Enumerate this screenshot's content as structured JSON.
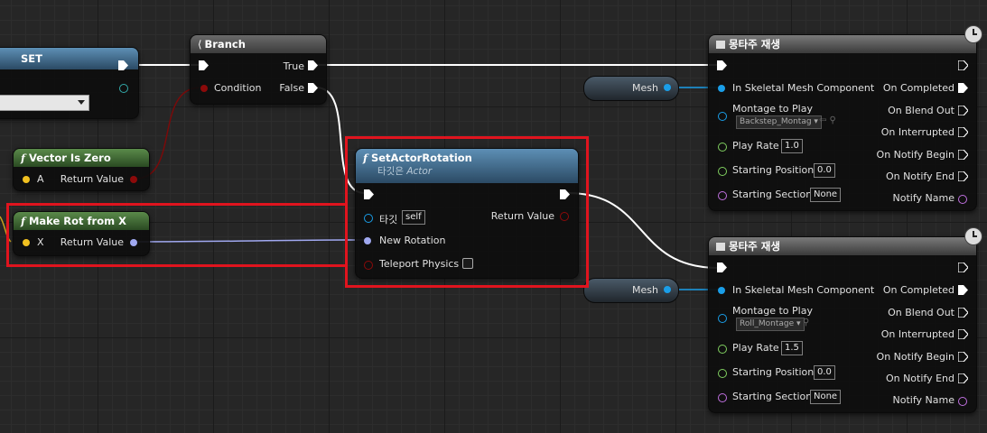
{
  "set_node": {
    "title": "SET"
  },
  "branch": {
    "title": "Branch",
    "true_label": "True",
    "false_label": "False",
    "condition_label": "Condition"
  },
  "vector_is_zero": {
    "title": "Vector Is Zero",
    "a_label": "A",
    "return_label": "Return Value"
  },
  "make_rot": {
    "title": "Make Rot from X",
    "x_label": "X",
    "return_label": "Return Value"
  },
  "set_actor_rotation": {
    "title": "SetActorRotation",
    "subtitle_prefix": "타깃은",
    "subtitle_target": "Actor",
    "target_label": "타깃",
    "target_value": "self",
    "return_label": "Return Value",
    "new_rotation_label": "New Rotation",
    "teleport_label": "Teleport Physics"
  },
  "montage_nodes": [
    {
      "title": "몽타주 재생",
      "mesh_var": "Mesh",
      "in_mesh_label": "In Skeletal Mesh Component",
      "montage_label": "Montage to Play",
      "montage_value": "Backstep_Montag",
      "play_rate_label": "Play Rate",
      "play_rate_value": "1.0",
      "start_pos_label": "Starting Position",
      "start_pos_value": "0.0",
      "start_section_label": "Starting Section",
      "start_section_value": "None",
      "on_completed": "On Completed",
      "on_blend_out": "On Blend Out",
      "on_interrupted": "On Interrupted",
      "on_notify_begin": "On Notify Begin",
      "on_notify_end": "On Notify End",
      "notify_name": "Notify Name"
    },
    {
      "title": "몽타주 재생",
      "mesh_var": "Mesh",
      "in_mesh_label": "In Skeletal Mesh Component",
      "montage_label": "Montage to Play",
      "montage_value": "Roll_Montage",
      "play_rate_label": "Play Rate",
      "play_rate_value": "1.5",
      "start_pos_label": "Starting Position",
      "start_pos_value": "0.0",
      "start_section_label": "Starting Section",
      "start_section_value": "None",
      "on_completed": "On Completed",
      "on_blend_out": "On Blend Out",
      "on_interrupted": "On Interrupted",
      "on_notify_begin": "On Notify Begin",
      "on_notify_end": "On Notify End",
      "notify_name": "Notify Name"
    }
  ],
  "colors": {
    "exec": "#ffffff",
    "bool": "#8c0a0a",
    "vector": "#f0c020",
    "rotator": "#a0a8f0",
    "object": "#1a9ee8",
    "float": "#80d060",
    "name": "#c070e0",
    "highlight": "#e0141e"
  }
}
